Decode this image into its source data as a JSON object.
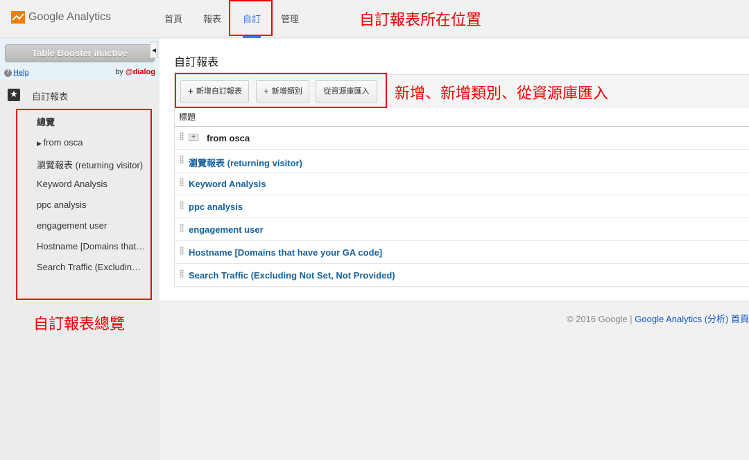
{
  "app": {
    "logo_text": "Google Analytics"
  },
  "nav": {
    "home": "首頁",
    "reports": "報表",
    "custom": "自訂",
    "admin": "管理"
  },
  "annotations": {
    "custom_location": "自訂報表所在位置",
    "add_actions": "新增、新增類別、從資源庫匯入",
    "overview": "自訂報表總覽"
  },
  "sidebar": {
    "table_booster": "Table Booster inactive",
    "help": "Help",
    "by_prefix": "by ",
    "by_brand": "@dialog",
    "section_label": "自訂報表",
    "items": [
      "總覽",
      "from osca",
      "瀏覽報表 (returning visitor)",
      "Keyword Analysis",
      "ppc analysis",
      "engagement user",
      "Hostname [Domains that have your GA code]",
      "Search Traffic (Excluding Not Set, Not Provided)"
    ]
  },
  "main": {
    "title": "自訂報表",
    "buttons": {
      "new_report_plus": "+",
      "new_report": "新增自訂報表",
      "new_category": "+ 新增類別",
      "import": "從資源庫匯入"
    },
    "column_header": "標題",
    "rows": [
      "from osca",
      "瀏覽報表 (returning visitor)",
      "Keyword Analysis",
      "ppc analysis",
      "engagement user",
      "Hostname [Domains that have your GA code]",
      "Search Traffic (Excluding Not Set, Not Provided)"
    ]
  },
  "footer": {
    "copyright": "© 2016 Google | ",
    "ga_link": "Google Analytics (分析) 首頁"
  },
  "colors": {
    "accent": "#3b78e7",
    "annotation_red": "#ee0000",
    "link_blue": "#15629e"
  }
}
